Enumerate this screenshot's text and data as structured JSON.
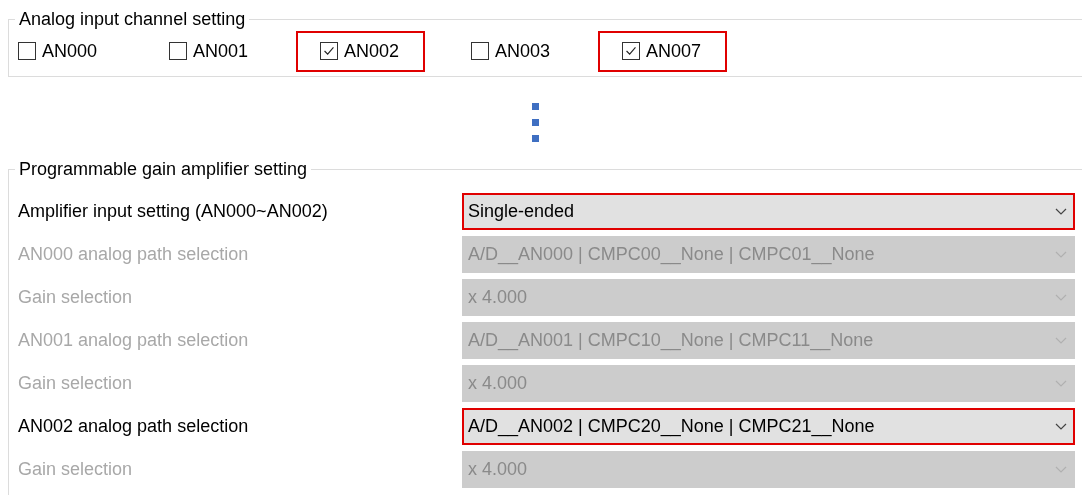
{
  "channel_group": {
    "title": "Analog input channel setting",
    "channels": [
      {
        "label": "AN000",
        "checked": false,
        "highlighted": false
      },
      {
        "label": "AN001",
        "checked": false,
        "highlighted": false
      },
      {
        "label": "AN002",
        "checked": true,
        "highlighted": true
      },
      {
        "label": "AN003",
        "checked": false,
        "highlighted": false
      },
      {
        "label": "AN007",
        "checked": true,
        "highlighted": true
      }
    ]
  },
  "pga_group": {
    "title": "Programmable gain amplifier setting",
    "rows": [
      {
        "label": "Amplifier input setting (AN000~AN002)",
        "value": "Single-ended",
        "disabled": false,
        "highlighted": true
      },
      {
        "label": "AN000 analog path selection",
        "value": "A/D__AN000 | CMPC00__None | CMPC01__None",
        "disabled": true,
        "highlighted": false
      },
      {
        "label": "Gain selection",
        "value": "x 4.000",
        "disabled": true,
        "highlighted": false
      },
      {
        "label": "AN001 analog path selection",
        "value": "A/D__AN001 | CMPC10__None | CMPC11__None",
        "disabled": true,
        "highlighted": false
      },
      {
        "label": "Gain selection",
        "value": "x 4.000",
        "disabled": true,
        "highlighted": false
      },
      {
        "label": "AN002 analog path selection",
        "value": "A/D__AN002 | CMPC20__None | CMPC21__None",
        "disabled": false,
        "highlighted": true
      },
      {
        "label": "Gain selection",
        "value": "x 4.000",
        "disabled": true,
        "highlighted": false
      }
    ]
  }
}
